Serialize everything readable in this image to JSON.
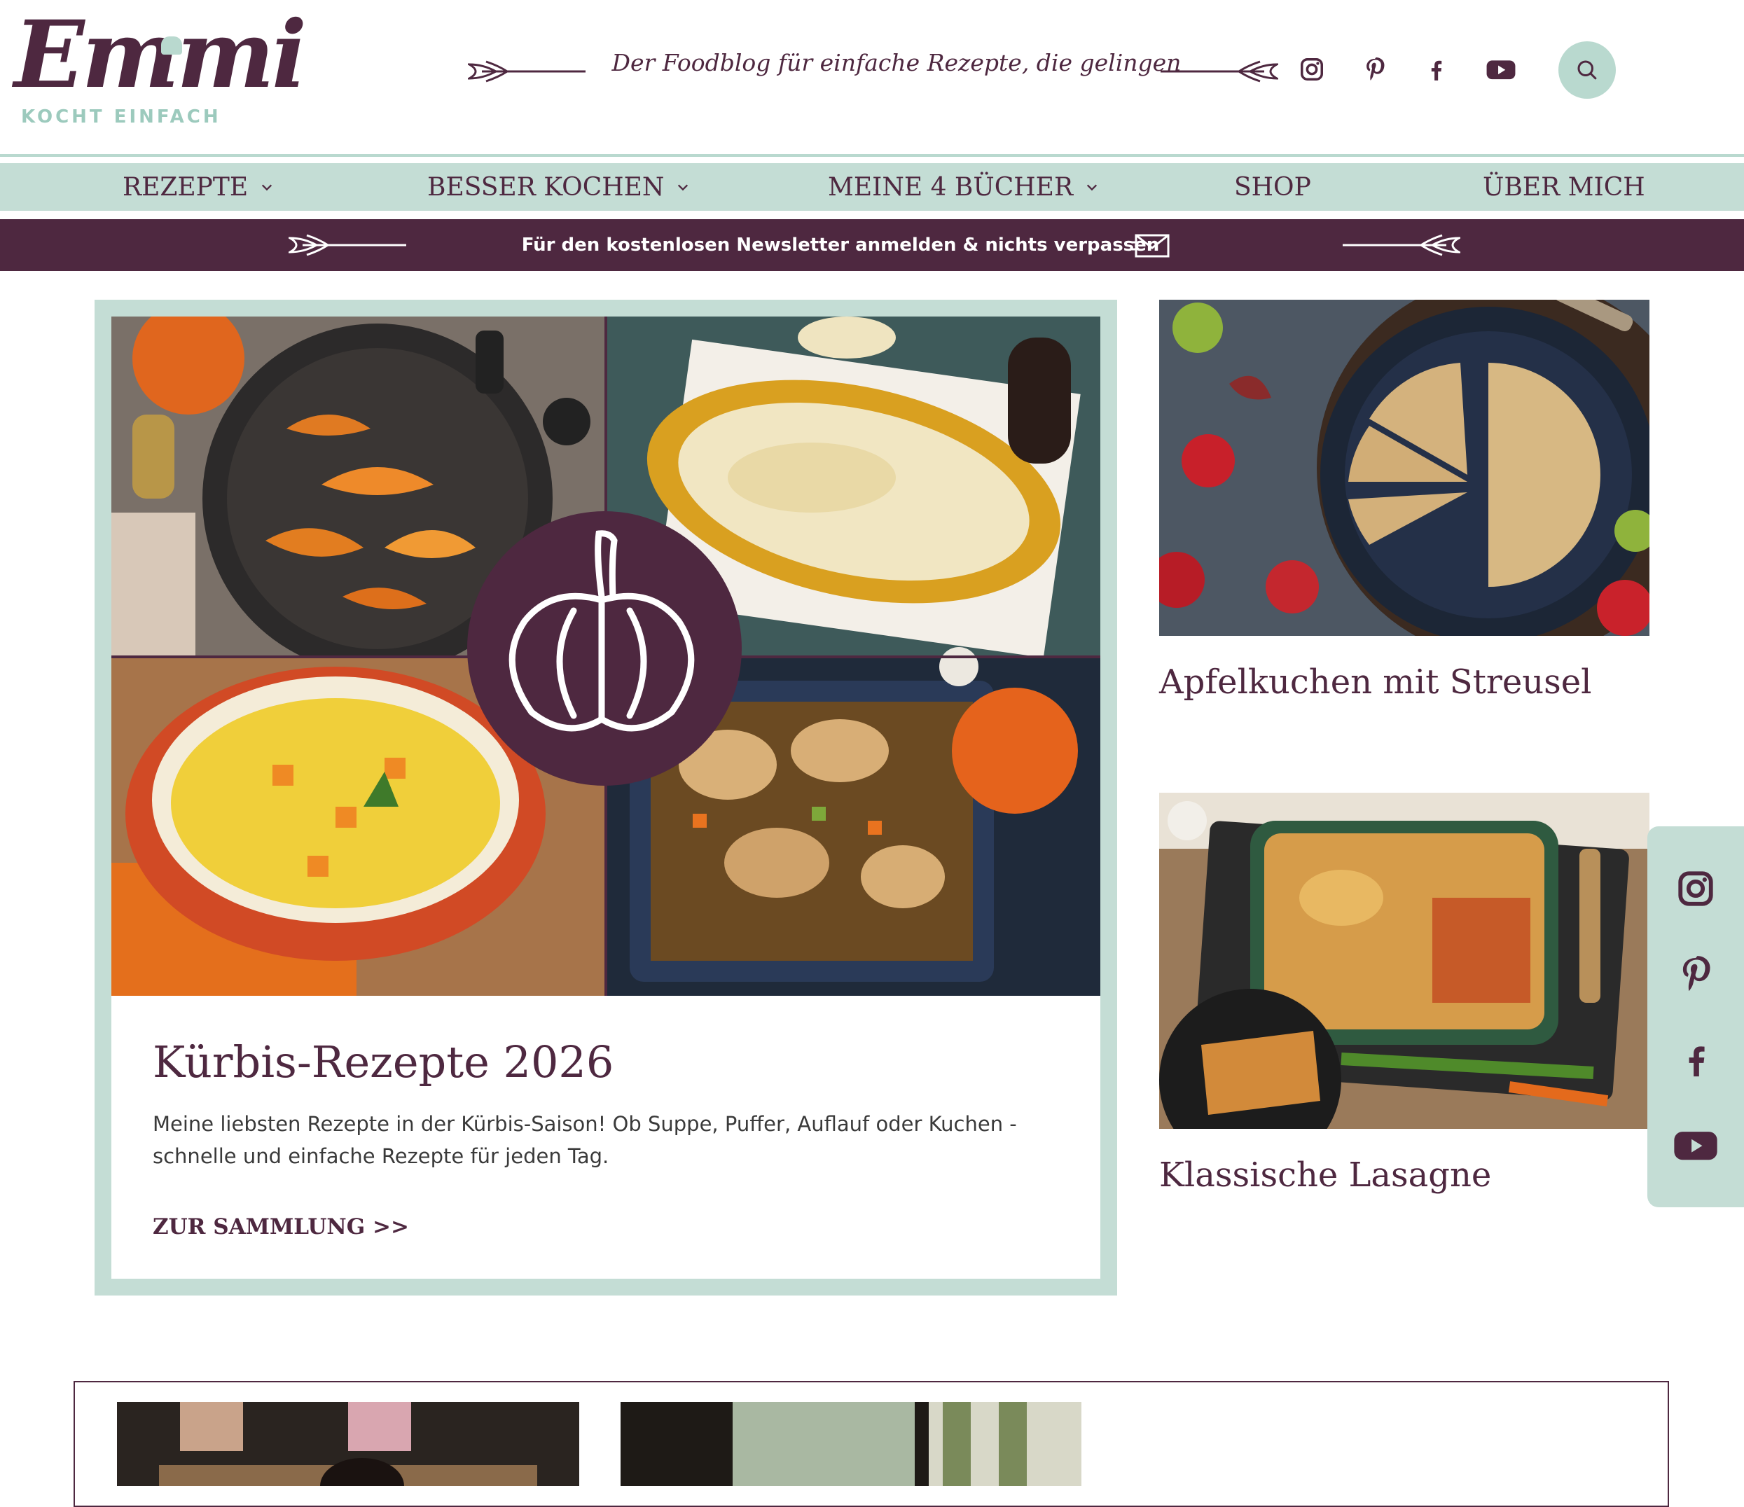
{
  "brand": {
    "logo_text": "Emmi",
    "logo_subtitle": "KOCHT EINFACH",
    "tagline": "Der Foodblog für einfache Rezepte, die gelingen"
  },
  "header_social": [
    {
      "icon": "instagram-icon"
    },
    {
      "icon": "pinterest-icon"
    },
    {
      "icon": "facebook-icon"
    },
    {
      "icon": "youtube-icon"
    }
  ],
  "nav": {
    "items": [
      {
        "label": "REZEPTE",
        "has_dropdown": true
      },
      {
        "label": "BESSER KOCHEN",
        "has_dropdown": true
      },
      {
        "label": "MEINE 4 BÜCHER",
        "has_dropdown": true
      },
      {
        "label": "SHOP",
        "has_dropdown": false
      },
      {
        "label": "ÜBER MICH",
        "has_dropdown": false
      }
    ]
  },
  "newsletter": {
    "text": "Für den kostenlosen Newsletter anmelden & nichts verpassen",
    "icon": "envelope-icon"
  },
  "featured": {
    "title": "Kürbis-Rezepte 2026",
    "description": "Meine liebsten Rezepte in der Kürbis-Saison! Ob Suppe, Puffer, Auflauf oder Kuchen - schnelle und einfache Rezepte für jeden Tag.",
    "link": "ZUR SAMMLUNG >>",
    "badge_icon": "pumpkin-icon"
  },
  "side_posts": [
    {
      "title": "Apfelkuchen mit Streusel"
    },
    {
      "title": "Klassische Lasagne"
    }
  ],
  "colors": {
    "plum": "#4e2840",
    "mint": "#c4ddd5",
    "mint_dark": "#9ccabd"
  }
}
